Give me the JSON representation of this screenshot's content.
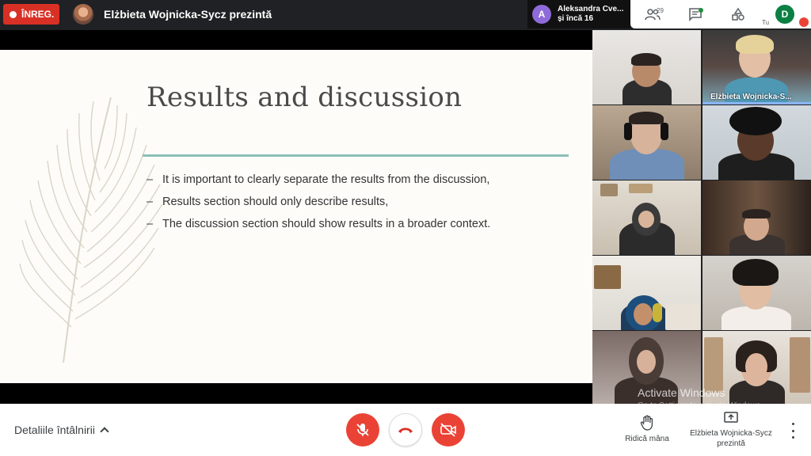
{
  "topbar": {
    "rec_label": "ÎNREG.",
    "presenter_title": "Elżbieta Wojnicka-Sycz prezintă",
    "others": {
      "initial": "A",
      "line1": "Aleksandra Cve...",
      "line2": "și încă 16"
    },
    "people_count": "29",
    "me_label": "Tu",
    "me_initial": "D"
  },
  "slide": {
    "title": "Results and discussion",
    "bullets": [
      "It is important to clearly separate the results from the discussion,",
      "Results section should only describe results,",
      "The discussion section should show results in a broader context."
    ],
    "bullet_marker": "–"
  },
  "participants": {
    "active_speaker_name": "Elżbieta Wojnicka-S..."
  },
  "watermark": {
    "title": "Activate Windows",
    "subtitle": "Go to Settings to activate Windows."
  },
  "bottombar": {
    "details_label": "Detaliile întâlnirii",
    "raise_hand_label": "Ridică mâna",
    "presenting_label": "Elżbieta Wojnicka-Sycz prezintă"
  },
  "colors": {
    "accent_red": "#ea4335",
    "rule_teal": "#8cbeb8",
    "slide_bg": "#fdfcf8"
  }
}
